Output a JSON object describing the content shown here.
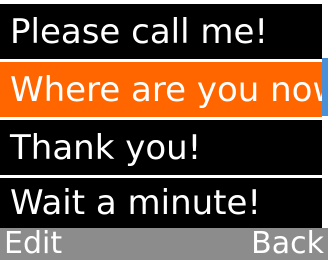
{
  "messages": [
    {
      "text": "Please call me!",
      "selected": false
    },
    {
      "text": "Where are you now?",
      "selected": true
    },
    {
      "text": "Thank you!",
      "selected": false
    },
    {
      "text": "Wait a minute!",
      "selected": false
    }
  ],
  "softkeys": {
    "left": "Edit",
    "right": "Back"
  },
  "colors": {
    "selected_background": "#ff6600",
    "item_background": "#000000",
    "softkey_bar": "#8c8c8c",
    "scrollbar_thumb": "#4a90d9"
  }
}
